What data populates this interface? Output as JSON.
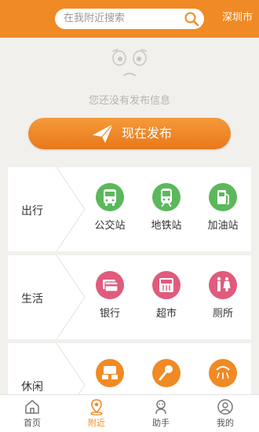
{
  "header": {
    "search_placeholder": "在我附近搜索",
    "city": "深圳市",
    "search_icon": "search-icon"
  },
  "empty_state": {
    "message": "您还没有发布信息",
    "publish_button": "现在发布"
  },
  "categories": [
    {
      "label": "出行",
      "items": [
        {
          "label": "公交站",
          "icon": "bus-icon",
          "color": "#5cb85c"
        },
        {
          "label": "地铁站",
          "icon": "metro-icon",
          "color": "#5cb85c"
        },
        {
          "label": "加油站",
          "icon": "gas-station-icon",
          "color": "#5cb85c"
        }
      ]
    },
    {
      "label": "生活",
      "items": [
        {
          "label": "银行",
          "icon": "bank-card-icon",
          "color": "#e05b7d"
        },
        {
          "label": "超市",
          "icon": "supermarket-icon",
          "color": "#e05b7d"
        },
        {
          "label": "厕所",
          "icon": "toilet-icon",
          "color": "#e05b7d"
        }
      ]
    },
    {
      "label": "休闲",
      "items": [
        {
          "label": "",
          "icon": "internet-cafe-icon",
          "color": "#f08a24"
        },
        {
          "label": "",
          "icon": "ktv-icon",
          "color": "#f08a24"
        },
        {
          "label": "",
          "icon": "spa-icon",
          "color": "#f08a24"
        }
      ]
    }
  ],
  "tabbar": {
    "tabs": [
      {
        "label": "首页",
        "icon": "home-icon"
      },
      {
        "label": "附近",
        "icon": "location-icon",
        "active": true
      },
      {
        "label": "助手",
        "icon": "assistant-icon"
      },
      {
        "label": "我的",
        "icon": "profile-icon"
      }
    ]
  },
  "colors": {
    "accent": "#f08a24",
    "background": "#f2f0ec",
    "travel": "#5cb85c",
    "life": "#e05b7d",
    "leisure": "#f08a24"
  }
}
